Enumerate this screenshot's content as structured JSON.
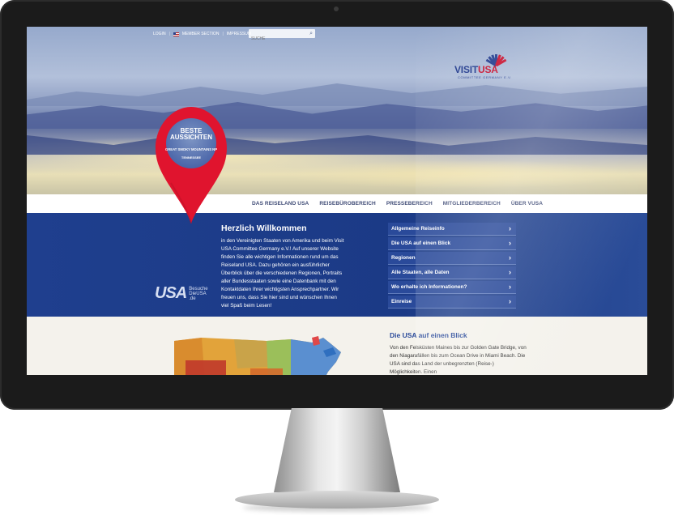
{
  "topbar": {
    "login": "LOGIN",
    "members": "MEMBER SECTION",
    "imprint": "IMPRESSUM",
    "search_placeholder": "SUCHE"
  },
  "logo": {
    "visit": "VISIT",
    "usa": "USA",
    "sub": "COMMITTEE GERMANY E.V."
  },
  "pin": {
    "title": "BESTE AUSSICHTEN",
    "subtitle": "GREAT SMOKY MOUNTAINS NP",
    "state": "TENNESSEE"
  },
  "nav": {
    "items": [
      {
        "label": "DAS REISELAND USA"
      },
      {
        "label": "REISEBÜROBEREICH"
      },
      {
        "label": "PRESSEBEREICH"
      },
      {
        "label": "MITGLIEDERBEREICH"
      },
      {
        "label": "ÜBER VUSA"
      }
    ]
  },
  "welcome": {
    "title": "Herzlich Willkommen",
    "text": "in den Vereinigten Staaten von Amerika und beim Visit USA Committee Germany e.V.! Auf unserer Website finden Sie alle wichtigen Informationen rund um das Reiseland USA. Dazu gehören ein ausführlicher Überblick über die verschiedenen Regionen, Portraits aller Bundesstaaten sowie eine Datenbank mit den Kontaktdaten Ihrer wichtigsten Ansprechpartner. Wir freuen uns, dass Sie hier sind und wünschen Ihnen viel Spaß beim Lesen!"
  },
  "usa_logo": {
    "big": "USA",
    "line1": "Besuche",
    "line2": "DieUSA",
    "line3": ".de"
  },
  "menu": {
    "items": [
      {
        "label": "Allgemeine Reiseinfo"
      },
      {
        "label": "Die USA auf einen Blick"
      },
      {
        "label": "Regionen"
      },
      {
        "label": "Alle Staaten, alle Daten"
      },
      {
        "label": "Wo erhalte ich Informationen?"
      },
      {
        "label": "Einreise"
      }
    ]
  },
  "section": {
    "title": "Die USA auf einen Blick",
    "text": "Von den Felsküsten Maines bis zur Golden Gate Bridge, von den Niagarafällen bis zum Ocean Drive in Miami Beach. Die USA sind das Land der unbegrenzten (Reise-) Möglichkeiten. Einen"
  },
  "colors": {
    "primary_blue": "#1f3f8e",
    "pin_red": "#e0142e",
    "nav_text": "#3f4b76"
  }
}
